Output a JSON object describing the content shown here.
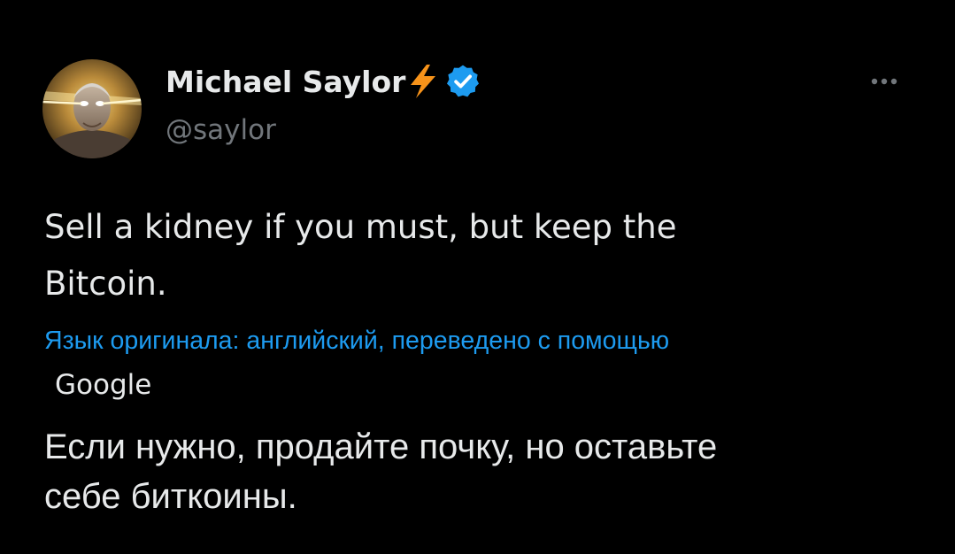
{
  "author": {
    "display_name": "Michael Saylor",
    "handle": "@saylor",
    "avatar_icon": "laser-eyes-portrait-avatar",
    "badge_icon": "lightning-bolt-icon",
    "verified_icon": "verified-badge-icon",
    "verified_color": "#1d9bf0",
    "bolt_color": "#f7931a"
  },
  "menu": {
    "more_icon": "more-horizontal-icon"
  },
  "tweet": {
    "text_line_1": "Sell a kidney if you must, but keep the",
    "text_line_2": "Bitcoin."
  },
  "translation": {
    "note": "Язык оригинала: английский, переведено с помощью",
    "provider": "Google",
    "text_line_1": "Если нужно, продайте почку, но оставьте",
    "text_line_2": "себе биткоины."
  },
  "colors": {
    "background": "#000000",
    "text_primary": "#e7e9ea",
    "text_secondary": "#71767b",
    "link": "#1d9bf0"
  }
}
